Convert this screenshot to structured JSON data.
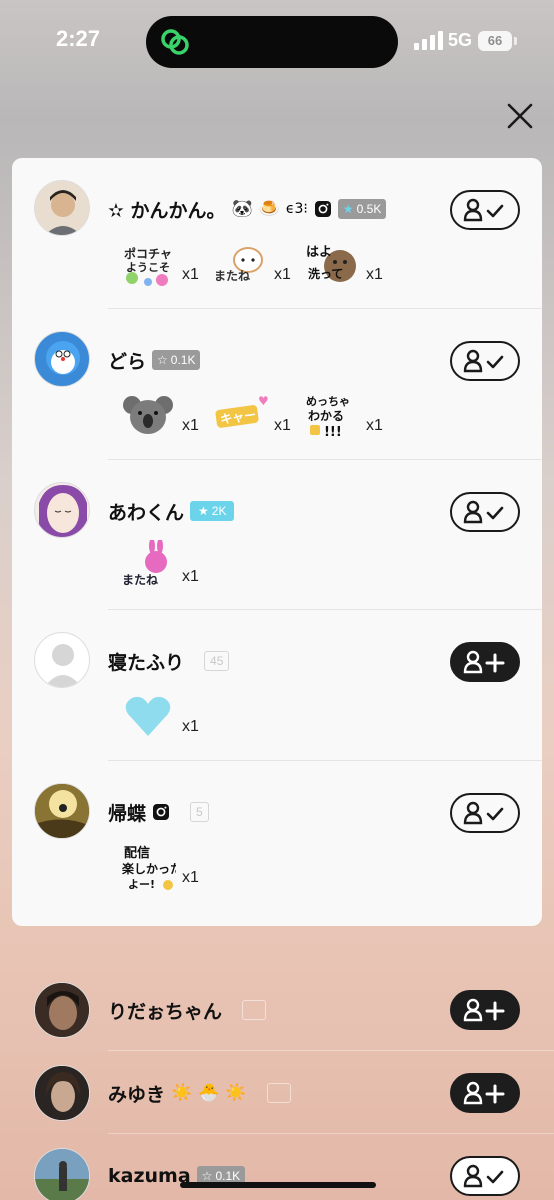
{
  "status_bar": {
    "time": "2:27",
    "network": "5G",
    "battery": "66"
  },
  "colors": {
    "accent_green": "#3ad36a",
    "badge_cyan": "#6cd4ea",
    "badge_gray": "#9a9a9a",
    "button_dark": "#1d1d1d"
  },
  "close_icon": "close-icon",
  "card_users": [
    {
      "name": "✫ かんかん。",
      "emojis": [
        "🐼",
        "🍮",
        "ϵ3⁝"
      ],
      "has_instagram": true,
      "badge": "0.5K",
      "badge_style": "gray",
      "following": true,
      "gifts": [
        {
          "sticker": "ポコチャへようこそ!",
          "count": "x1"
        },
        {
          "sticker": "またね!",
          "count": "x1"
        },
        {
          "sticker": "はよ洗って",
          "count": "x1"
        }
      ]
    },
    {
      "name": "どら",
      "emojis": [],
      "has_instagram": false,
      "badge": "0.1K",
      "badge_style": "gray",
      "following": true,
      "gifts": [
        {
          "sticker": "koala",
          "count": "x1"
        },
        {
          "sticker": "キャー",
          "count": "x1"
        },
        {
          "sticker": "めっちゃわかる!!!",
          "count": "x1"
        }
      ]
    },
    {
      "name": "あわくん",
      "emojis": [],
      "has_instagram": false,
      "badge": "2K",
      "badge_style": "cyan",
      "following": true,
      "gifts": [
        {
          "sticker": "またね!",
          "count": "x1"
        }
      ]
    },
    {
      "name": "寝たふり",
      "emojis": [],
      "has_instagram": false,
      "badge": "45",
      "badge_style": "outline",
      "following": false,
      "gifts": [
        {
          "sticker": "heart",
          "count": "x1"
        }
      ]
    },
    {
      "name": "帰蝶",
      "emojis": [],
      "has_instagram": true,
      "badge": "5",
      "badge_style": "outline",
      "following": true,
      "gifts": [
        {
          "sticker": "配信楽しかったよー!",
          "count": "x1"
        }
      ]
    }
  ],
  "list_users": [
    {
      "name": "りだぉちゃん",
      "emojis": [],
      "badge": "",
      "following": false
    },
    {
      "name": "みゆき",
      "emojis": [
        "☀️",
        "🐣",
        "☀️"
      ],
      "badge": "",
      "following": false
    },
    {
      "name": "kazuma",
      "emojis": [],
      "badge": "0.1K",
      "following": true
    }
  ]
}
